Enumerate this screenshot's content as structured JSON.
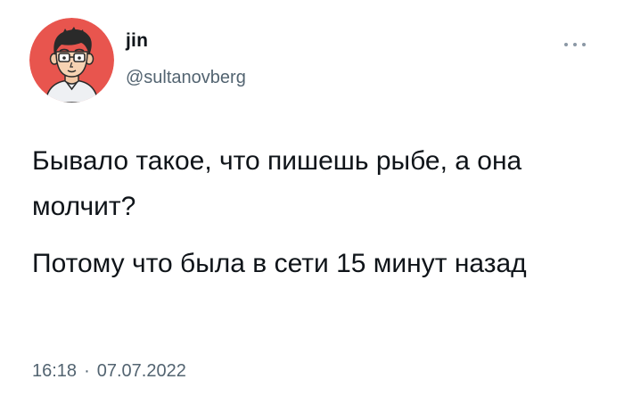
{
  "author": {
    "name": "jin",
    "handle": "@sultanovberg"
  },
  "tweet": {
    "paragraphs": [
      "Бывало такое, что пишешь рыбе, а она молчит?",
      "Потому что была в сети 15 минут назад"
    ],
    "time": "16:18",
    "separator": "·",
    "date": "07.07.2022"
  },
  "icons": {
    "avatar": "cartoon-man-with-glasses",
    "more": "more-horizontal-icon"
  },
  "colors": {
    "avatar_background": "#e8554e",
    "text": "#0f1419",
    "secondary_text": "#536471"
  }
}
